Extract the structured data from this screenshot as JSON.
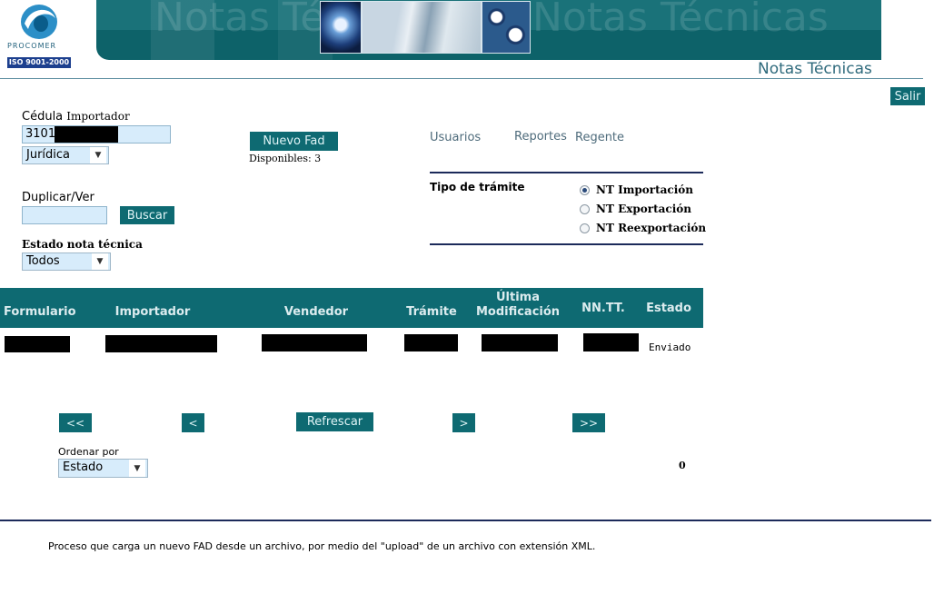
{
  "header": {
    "logo_name": "PROCOMER",
    "logo_badge": "ISO 9001-2000",
    "banner_watermark": "Notas Técnicas",
    "title": "Notas Técnicas",
    "logout_label": "Salir"
  },
  "importer": {
    "label_cedula": "Cédula",
    "label_importador": "Importador",
    "cedula_value": "3101",
    "type_selected": "Jurídica",
    "new_fad_label": "Nuevo Fad",
    "available_label": "Disponibles: 3"
  },
  "nav": {
    "users": "Usuarios",
    "reports": "Reportes",
    "regent": "Regente"
  },
  "duplicate": {
    "label": "Duplicar/Ver",
    "value": "",
    "search_label": "Buscar"
  },
  "status_filter": {
    "label": "Estado nota técnica",
    "selected": "Todos"
  },
  "procedure": {
    "label": "Tipo de trámite",
    "options": [
      {
        "label": "NT Importación",
        "checked": true
      },
      {
        "label": "NT Exportación",
        "checked": false
      },
      {
        "label": "NT Reexportación",
        "checked": false
      }
    ]
  },
  "table": {
    "headers": [
      "Formulario",
      "Importador",
      "Vendedor",
      "Trámite",
      "Última Modificación",
      "NN.TT.",
      "Estado"
    ],
    "rows": [
      {
        "estado": "Enviado"
      }
    ]
  },
  "pagination": {
    "first": "<<",
    "prev": "<",
    "refresh": "Refrescar",
    "next": ">",
    "last": ">>"
  },
  "sort": {
    "label": "Ordenar por",
    "selected": "Estado",
    "count": "0"
  },
  "footer": {
    "text": "Proceso que carga un nuevo FAD desde un archivo, por medio del \"upload\" de un archivo con extensión XML."
  }
}
